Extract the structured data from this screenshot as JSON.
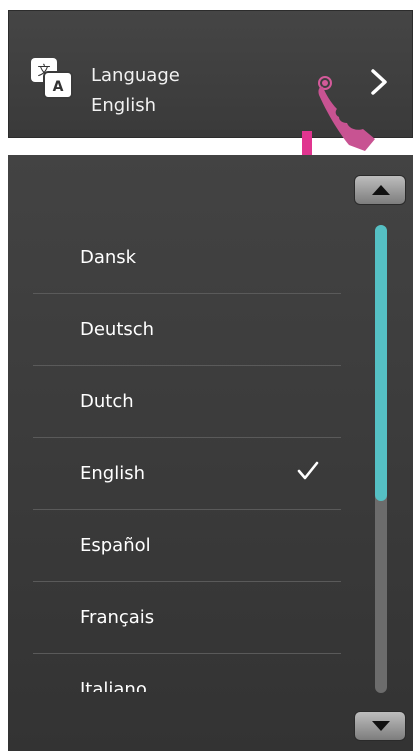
{
  "setting": {
    "title": "Language",
    "value": "English",
    "icon": "translate-icon",
    "chevron": "chevron-right-icon"
  },
  "annotation": {
    "hand": "hand-pointer-icon",
    "arrow": "down-arrow-icon",
    "arrow_color": "#e0358f"
  },
  "languages": {
    "items": [
      {
        "label": "Dansk",
        "selected": false
      },
      {
        "label": "Deutsch",
        "selected": false
      },
      {
        "label": "Dutch",
        "selected": false
      },
      {
        "label": "English",
        "selected": true
      },
      {
        "label": "Español",
        "selected": false
      },
      {
        "label": "Français",
        "selected": false
      },
      {
        "label": "Italiano",
        "selected": false
      }
    ],
    "check_icon": "check-icon"
  },
  "scrollbar": {
    "up_icon": "caret-up-icon",
    "down_icon": "caret-down-icon",
    "thumb_color": "#55c0c4",
    "visible_fraction": 0.59
  }
}
